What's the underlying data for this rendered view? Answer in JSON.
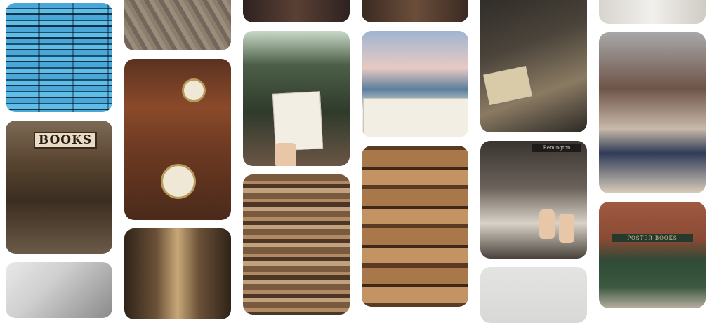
{
  "pins": [
    {
      "id": "p1",
      "signs": {}
    },
    {
      "id": "p2",
      "signs": {
        "main": "BOOKS"
      }
    },
    {
      "id": "p3",
      "signs": {}
    },
    {
      "id": "p4",
      "signs": {}
    },
    {
      "id": "p5",
      "signs": {}
    },
    {
      "id": "p6",
      "signs": {}
    },
    {
      "id": "p7",
      "signs": {}
    },
    {
      "id": "p8",
      "signs": {}
    },
    {
      "id": "p9",
      "signs": {}
    },
    {
      "id": "p10",
      "signs": {}
    },
    {
      "id": "p11",
      "signs": {}
    },
    {
      "id": "p12",
      "signs": {}
    },
    {
      "id": "p13",
      "signs": {}
    },
    {
      "id": "p14",
      "signs": {
        "main": "Remington"
      }
    },
    {
      "id": "p15",
      "signs": {}
    },
    {
      "id": "p16",
      "signs": {}
    },
    {
      "id": "p17",
      "signs": {}
    },
    {
      "id": "p18",
      "signs": {
        "main": "POSTER BOOKS"
      }
    }
  ],
  "colors": {
    "background": "#ffffff"
  }
}
